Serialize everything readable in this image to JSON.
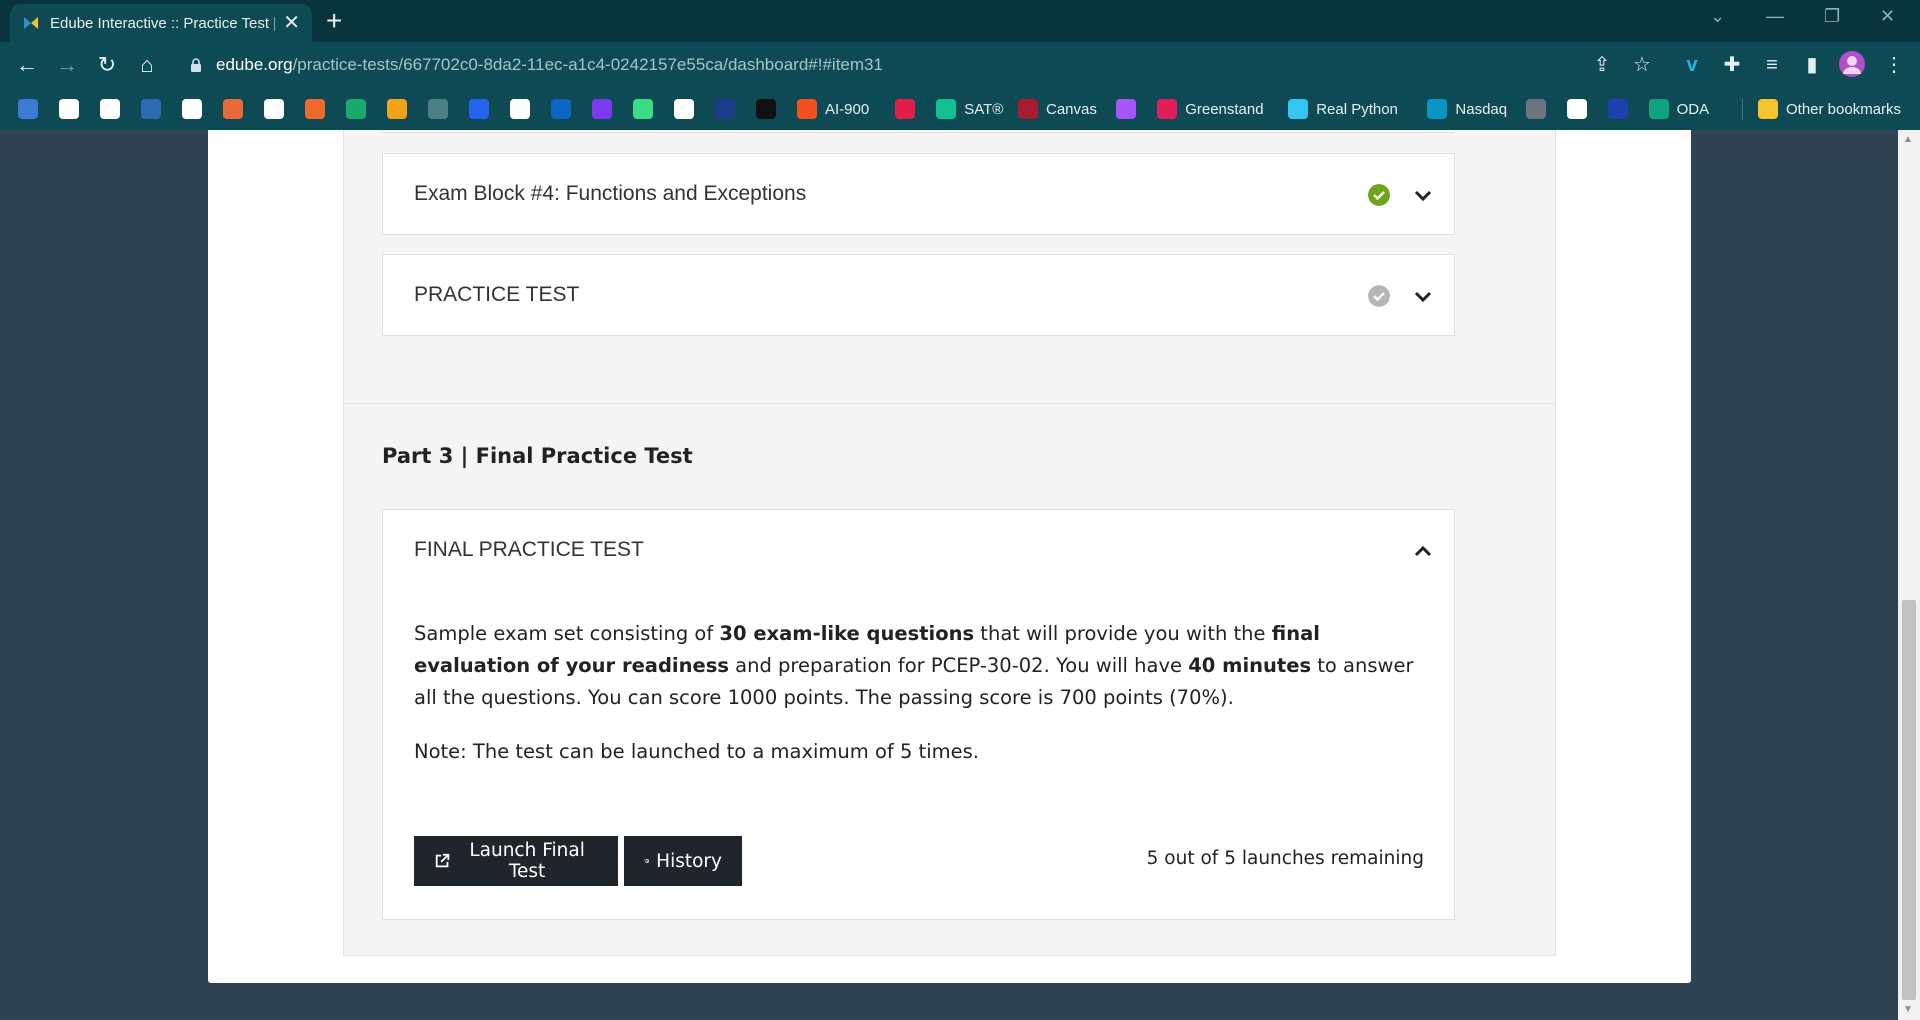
{
  "browser": {
    "tab_title": "Edube Interactive :: Practice Test |",
    "url_host": "edube.org",
    "url_path": "/practice-tests/667702c0-8da2-11ec-a1c4-0242157e55ca/dashboard#!#item31"
  },
  "bookmarks": [
    {
      "label": "",
      "icon": "stack-icon",
      "color": "#3b7bd6"
    },
    {
      "label": "",
      "icon": "github-icon",
      "color": "#ffffff"
    },
    {
      "label": "",
      "icon": "circle-logo-icon",
      "color": "#ffffff"
    },
    {
      "label": "",
      "icon": "blue-square-icon",
      "color": "#2b6cb0"
    },
    {
      "label": "",
      "icon": "printer-icon",
      "color": "#ffffff"
    },
    {
      "label": "",
      "icon": "swirl-icon",
      "color": "#e86a3a"
    },
    {
      "label": "",
      "icon": "lambda-icon",
      "color": "#ffffff"
    },
    {
      "label": "",
      "icon": "flame-icon",
      "color": "#f06b2b"
    },
    {
      "label": "",
      "icon": "hackerrank-icon",
      "color": "#1aa86b"
    },
    {
      "label": "",
      "icon": "layers-icon",
      "color": "#f2a21b"
    },
    {
      "label": "",
      "icon": "grid-icon",
      "color": "#4d7f86"
    },
    {
      "label": "",
      "icon": "c-logo-icon",
      "color": "#2563eb"
    },
    {
      "label": "",
      "icon": "edx-icon",
      "color": "#ffffff"
    },
    {
      "label": "",
      "icon": "linkedin-icon",
      "color": "#0a66c2"
    },
    {
      "label": "",
      "icon": "u-logo-icon",
      "color": "#7c3aed"
    },
    {
      "label": "",
      "icon": "android-icon",
      "color": "#3ddc84"
    },
    {
      "label": "",
      "icon": "code-icon",
      "color": "#ffffff"
    },
    {
      "label": "",
      "icon": "h-logo-icon",
      "color": "#1e3a8a"
    },
    {
      "label": "",
      "icon": "terminal-icon",
      "color": "#111111"
    },
    {
      "label": "AI-900",
      "icon": "microsoft-icon",
      "color": "#f25022"
    },
    {
      "label": "",
      "icon": "red-box-icon",
      "color": "#e11d48"
    },
    {
      "label": "SAT®",
      "icon": "khan-icon",
      "color": "#14bf96"
    },
    {
      "label": "Canvas",
      "icon": "harvard-icon",
      "color": "#a51c30"
    },
    {
      "label": "",
      "icon": "ed-icon",
      "color": "#a855f7"
    },
    {
      "label": "Greenstand",
      "icon": "slack-icon",
      "color": "#e01e5a"
    },
    {
      "label": "Real Python",
      "icon": "slack-icon",
      "color": "#36c5f0"
    },
    {
      "label": "Nasdaq",
      "icon": "nasdaq-icon",
      "color": "#0996c7"
    },
    {
      "label": "",
      "icon": "aai-icon",
      "color": "#6b7280"
    },
    {
      "label": "",
      "icon": "mw-icon",
      "color": "#ffffff"
    },
    {
      "label": "",
      "icon": "p-logo-icon",
      "color": "#1e40af"
    },
    {
      "label": "ODA",
      "icon": "openai-icon",
      "color": "#10a37f"
    }
  ],
  "other_bookmarks": "Other bookmarks",
  "blocks": [
    {
      "title": "Exam Block #4: Functions and Exceptions",
      "status_color": "#6aa51a"
    },
    {
      "title": "PRACTICE TEST",
      "status_color": "#b5b5b5"
    }
  ],
  "part3": {
    "title": "Part 3 | Final Practice Test",
    "accordion_title": "FINAL PRACTICE TEST",
    "desc_1": "Sample exam set consisting of ",
    "desc_b1": "30 exam-like questions",
    "desc_2": " that will provide you with the ",
    "desc_b2": "final evaluation of your readiness",
    "desc_3": " and preparation for PCEP-30-02. You will have ",
    "desc_b3": "40 minutes",
    "desc_4": " to answer all the questions. You can score 1000 points. The passing score is 700 points (70%).",
    "note": "Note: The test can be launched to a maximum of 5 times.",
    "launch_label": "Launch Final Test",
    "history_label": "History",
    "launches_remaining": "5 out of 5 launches remaining"
  }
}
